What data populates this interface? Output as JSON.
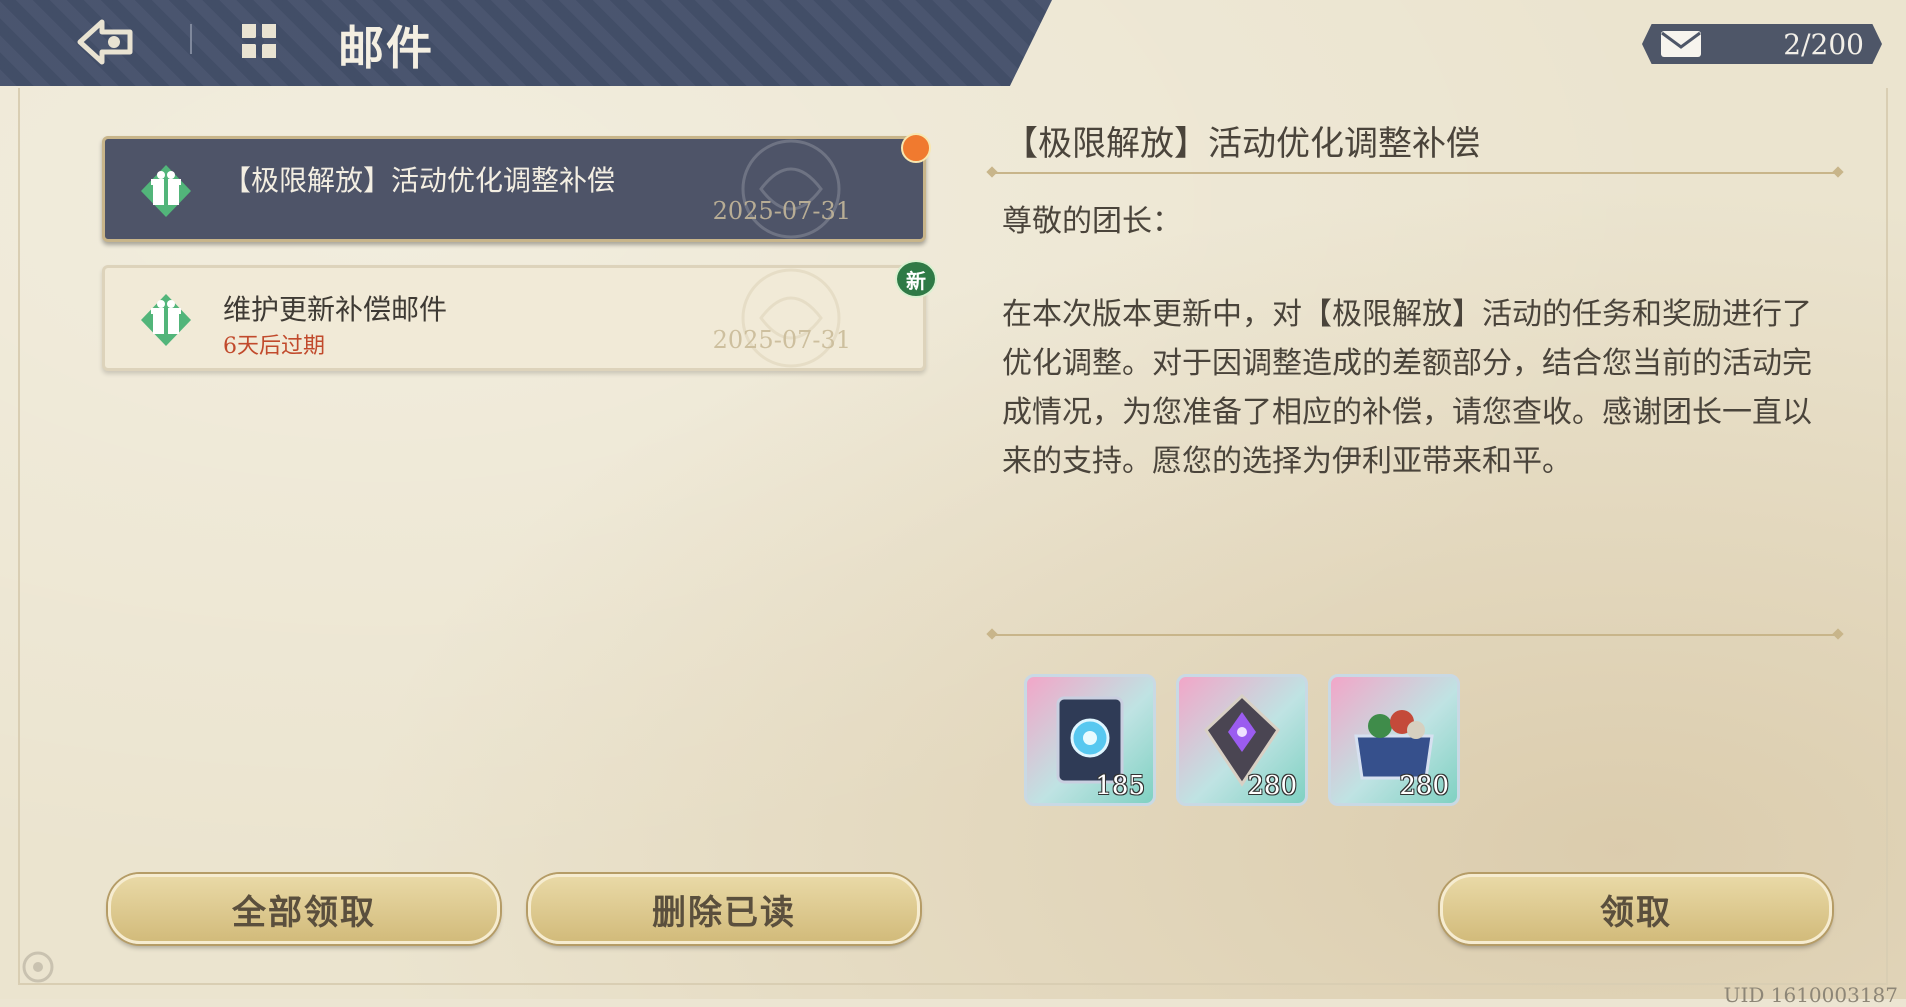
{
  "header": {
    "title": "邮件"
  },
  "counter": {
    "value": "2/200"
  },
  "mails": [
    {
      "subject": "【极限解放】活动优化调整补偿",
      "date": "2025-07-31"
    },
    {
      "subject": "维护更新补偿邮件",
      "expire": "6天后过期",
      "date": "2025-07-31",
      "badge": "新"
    }
  ],
  "detail": {
    "title": "【极限解放】活动优化调整补偿",
    "greeting": "尊敬的团长：",
    "body": "在本次版本更新中，对【极限解放】活动的任务和奖励进行了优化调整。对于因调整造成的差额部分，结合您当前的活动完成情况，为您准备了相应的补偿，请您查收。感谢团长一直以来的支持。愿您的选择为伊利亚带来和平。",
    "items": [
      {
        "icon": "book-icon",
        "qty": "185"
      },
      {
        "icon": "crystal-icon",
        "qty": "280"
      },
      {
        "icon": "chest-icon",
        "qty": "280"
      }
    ]
  },
  "buttons": {
    "claim_all": "全部领取",
    "delete_read": "删除已读",
    "claim": "领取"
  },
  "uid": "UID 1610003187",
  "colors": {
    "header": "#44506a",
    "selected": "#4e5468",
    "gold": "#c8b58a",
    "expire": "#c14a2c"
  }
}
